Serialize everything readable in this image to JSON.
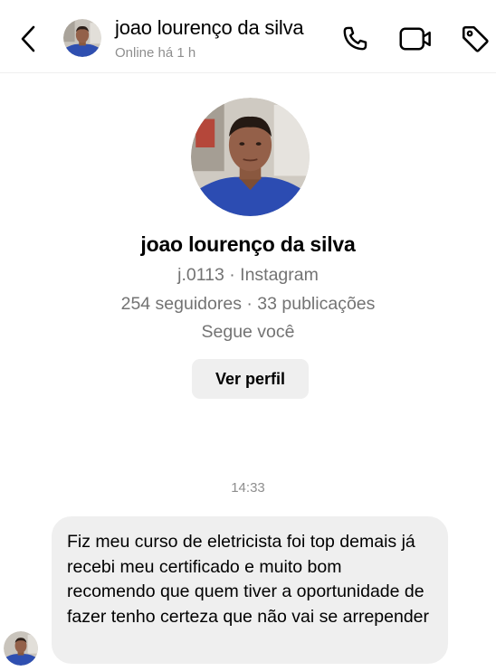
{
  "header": {
    "back_icon": "chevron-left-icon",
    "name": "joao lourenço da silva",
    "status": "Online há 1 h",
    "icons": [
      "phone-icon",
      "video-icon",
      "tag-icon"
    ]
  },
  "profile": {
    "name": "joao lourenço da silva",
    "handle": "j.0113 · Instagram",
    "stats": "254 seguidores · 33 publicações",
    "follows": "Segue você",
    "view_button": "Ver perfil"
  },
  "conversation": {
    "timestamp": "14:33",
    "messages": [
      {
        "text": "Fiz meu curso de eletricista foi top demais já recebi meu certificado e muito bom recomendo que quem tiver a oportunidade de fazer tenho certeza que não vai se arrepender"
      }
    ]
  },
  "colors": {
    "secondary_text": "#737373",
    "bubble_background": "#efefef",
    "button_background": "#efefef"
  }
}
